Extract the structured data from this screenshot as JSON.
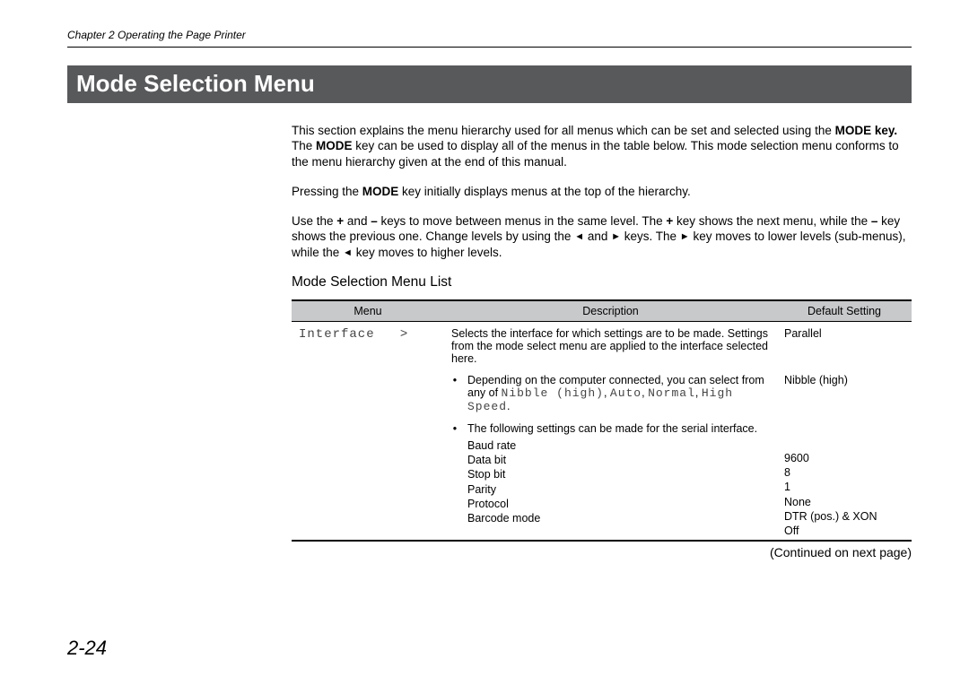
{
  "header": {
    "chapter": "Chapter 2  Operating the Page Printer"
  },
  "title": "Mode Selection Menu",
  "paragraphs": {
    "p1a": "This section explains the menu hierarchy used for all menus which can be set and selected using the ",
    "p1b": "MODE key.",
    "p1c": "  The ",
    "p1d": "MODE",
    "p1e": " key can be used to display all of the menus in the table below.  This mode selection menu conforms to the menu hierarchy given at the end of this manual.",
    "p2a": "Pressing the ",
    "p2b": "MODE",
    "p2c": " key initially displays menus at the top of the hierarchy.",
    "p3a": "Use the ",
    "p3b": "+",
    "p3c": " and ",
    "p3d": "–",
    "p3e": " keys to move between menus in the same level.  The ",
    "p3f": "+",
    "p3g": " key shows the next menu, while the ",
    "p3h": "–",
    "p3i": " key shows the previous one.  Change levels by using the  ",
    "p3j": "  and  ",
    "p3k": " keys.  The  ",
    "p3l": "  key moves  to lower levels (sub-menus), while the  ",
    "p3m": "  key moves to higher levels."
  },
  "arrows": {
    "left": "◄",
    "right": "►"
  },
  "subheading": "Mode Selection Menu List",
  "table": {
    "headers": {
      "menu": "Menu",
      "desc": "Description",
      "def": "Default Setting"
    },
    "row1": {
      "menu": "Interface   >",
      "desc": "Selects the interface for which settings are to be made. Settings from the mode select menu are applied to the interface selected here.",
      "def": "Parallel"
    },
    "row2": {
      "descA": "Depending on the computer connected, you can select from any of ",
      "descB": "Nibble (high)",
      "descC": ", ",
      "descD": "Auto",
      "descE": ", ",
      "descF": "Normal",
      "descG": ", ",
      "descH": "High Speed",
      "descI": ".",
      "def": "Nibble (high)"
    },
    "row3": {
      "intro": "The following settings can be made for the serial interface.",
      "items": {
        "i1": "Baud rate",
        "i2": "Data bit",
        "i3": "Stop bit",
        "i4": "Parity",
        "i5": "Protocol",
        "i6": "Barcode mode"
      },
      "defaults": {
        "d1": "9600",
        "d2": "8",
        "d3": "1",
        "d4": "None",
        "d5": "DTR (pos.) & XON",
        "d6": "Off"
      }
    }
  },
  "continued": "(Continued on next page)",
  "pageNumber": "2-24"
}
